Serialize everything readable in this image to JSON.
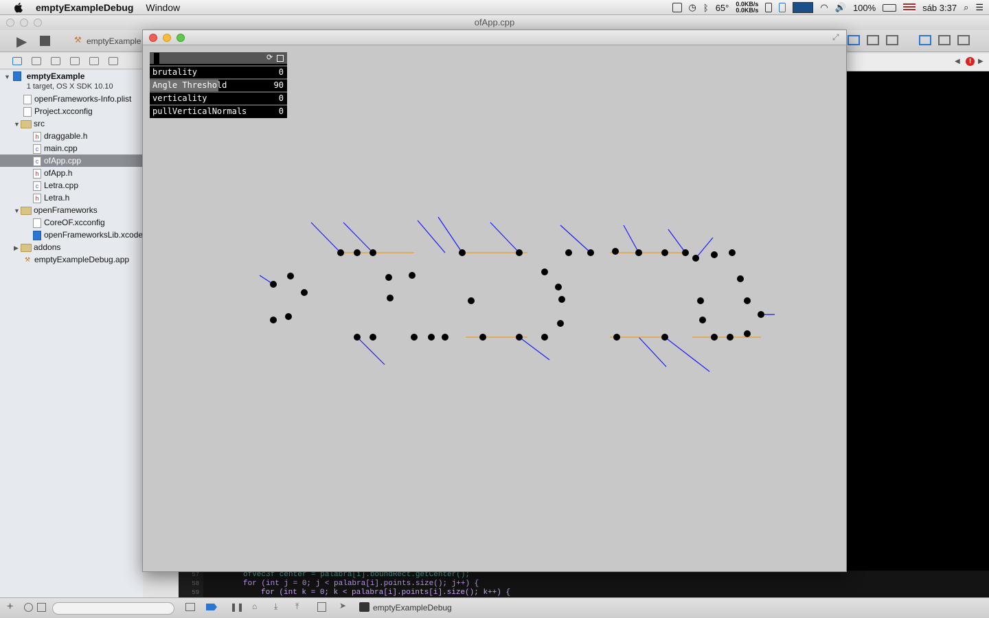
{
  "menubar": {
    "app_name": "emptyExampleDebug",
    "menu_window": "Window",
    "temperature": "65°",
    "net_up": "0.0KB/s",
    "net_down": "0.0KB/s",
    "battery": "100%",
    "clock": "sáb 3:37"
  },
  "xcode": {
    "window_title": "ofApp.cpp",
    "scheme": "emptyExample",
    "project": {
      "name": "emptyExample",
      "subtitle": "1 target, OS X SDK 10.10"
    },
    "files": [
      {
        "label": "openFrameworks-Info.plist"
      },
      {
        "label": "Project.xcconfig"
      },
      {
        "label": "src"
      },
      {
        "label": "draggable.h"
      },
      {
        "label": "main.cpp"
      },
      {
        "label": "ofApp.cpp"
      },
      {
        "label": "ofApp.h"
      },
      {
        "label": "Letra.cpp"
      },
      {
        "label": "Letra.h"
      },
      {
        "label": "openFrameworks"
      },
      {
        "label": "CoreOF.xcconfig"
      },
      {
        "label": "openFrameworksLib.xcodeproj"
      },
      {
        "label": "addons"
      },
      {
        "label": "emptyExampleDebug.app"
      }
    ],
    "code_lines": [
      {
        "num": "57",
        "text": "ofVec3f center = palabra[i].boundRect.getCenter();"
      },
      {
        "num": "58",
        "text": "for (int j = 0; j < palabra[i].points.size(); j++) {"
      },
      {
        "num": "59",
        "text": "for (int k = 0; k < palabra[i].points[i].size(); k++) {"
      }
    ],
    "debug_target": "emptyExampleDebug"
  },
  "gui": {
    "params": [
      {
        "name": "brutality",
        "value": "0",
        "level": 0
      },
      {
        "name": "Angle Threshold",
        "value": "90",
        "level": 0.5
      },
      {
        "name": "verticality",
        "value": "0",
        "level": 0
      },
      {
        "name": "pullVerticalNormals",
        "value": "0",
        "level": 0
      }
    ]
  },
  "canvas": {
    "word": "aIkABW3",
    "fill_color": "#ff0000",
    "normal_color": "#1a1aff",
    "point_color": "#000000",
    "bbox_color": "#e8a23a"
  }
}
